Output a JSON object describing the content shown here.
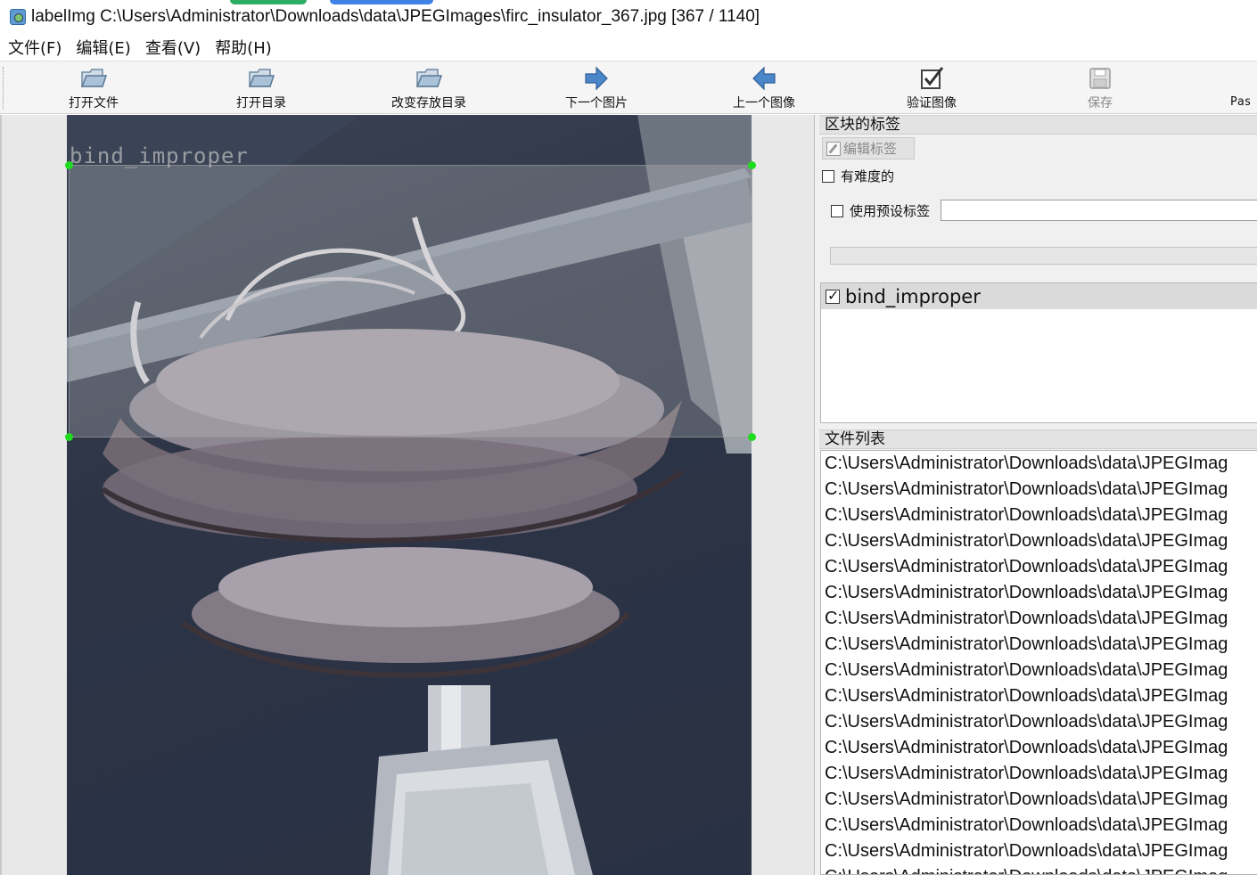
{
  "window": {
    "title": "labelImg C:\\Users\\Administrator\\Downloads\\data\\JPEGImages\\firc_insulator_367.jpg [367 / 1140]"
  },
  "menu": [
    "文件(F)",
    "编辑(E)",
    "查看(V)",
    "帮助(H)"
  ],
  "toolbar": {
    "open_file": "打开文件",
    "open_dir": "打开目录",
    "change_save_dir": "改变存放目录",
    "next_image": "下一个图片",
    "prev_image": "上一个图像",
    "verify_image": "验证图像",
    "save": "保存",
    "pascal": "Pas"
  },
  "canvas": {
    "box_label": "bind_improper"
  },
  "labels_dock": {
    "title": "区块的标签",
    "edit_label_button": "编辑标签",
    "difficult_checkbox": "有难度的",
    "difficult_checked": false,
    "use_default_label_checkbox": "使用预设标签",
    "use_default_label_checked": false,
    "default_label_value": "",
    "labels": [
      {
        "name": "bind_improper",
        "checked": true
      }
    ]
  },
  "file_dock": {
    "title": "文件列表",
    "files": [
      "C:\\Users\\Administrator\\Downloads\\data\\JPEGImag",
      "C:\\Users\\Administrator\\Downloads\\data\\JPEGImag",
      "C:\\Users\\Administrator\\Downloads\\data\\JPEGImag",
      "C:\\Users\\Administrator\\Downloads\\data\\JPEGImag",
      "C:\\Users\\Administrator\\Downloads\\data\\JPEGImag",
      "C:\\Users\\Administrator\\Downloads\\data\\JPEGImag",
      "C:\\Users\\Administrator\\Downloads\\data\\JPEGImag",
      "C:\\Users\\Administrator\\Downloads\\data\\JPEGImag",
      "C:\\Users\\Administrator\\Downloads\\data\\JPEGImag",
      "C:\\Users\\Administrator\\Downloads\\data\\JPEGImag",
      "C:\\Users\\Administrator\\Downloads\\data\\JPEGImag",
      "C:\\Users\\Administrator\\Downloads\\data\\JPEGImag",
      "C:\\Users\\Administrator\\Downloads\\data\\JPEGImag",
      "C:\\Users\\Administrator\\Downloads\\data\\JPEGImag",
      "C:\\Users\\Administrator\\Downloads\\data\\JPEGImag",
      "C:\\Users\\Administrator\\Downloads\\data\\JPEGImag",
      "C:\\Users\\Administrator\\Downloads\\data\\JPEGImag"
    ]
  },
  "colors": {
    "handle": "#1fdc1f",
    "arrow": "#4a86c8"
  }
}
